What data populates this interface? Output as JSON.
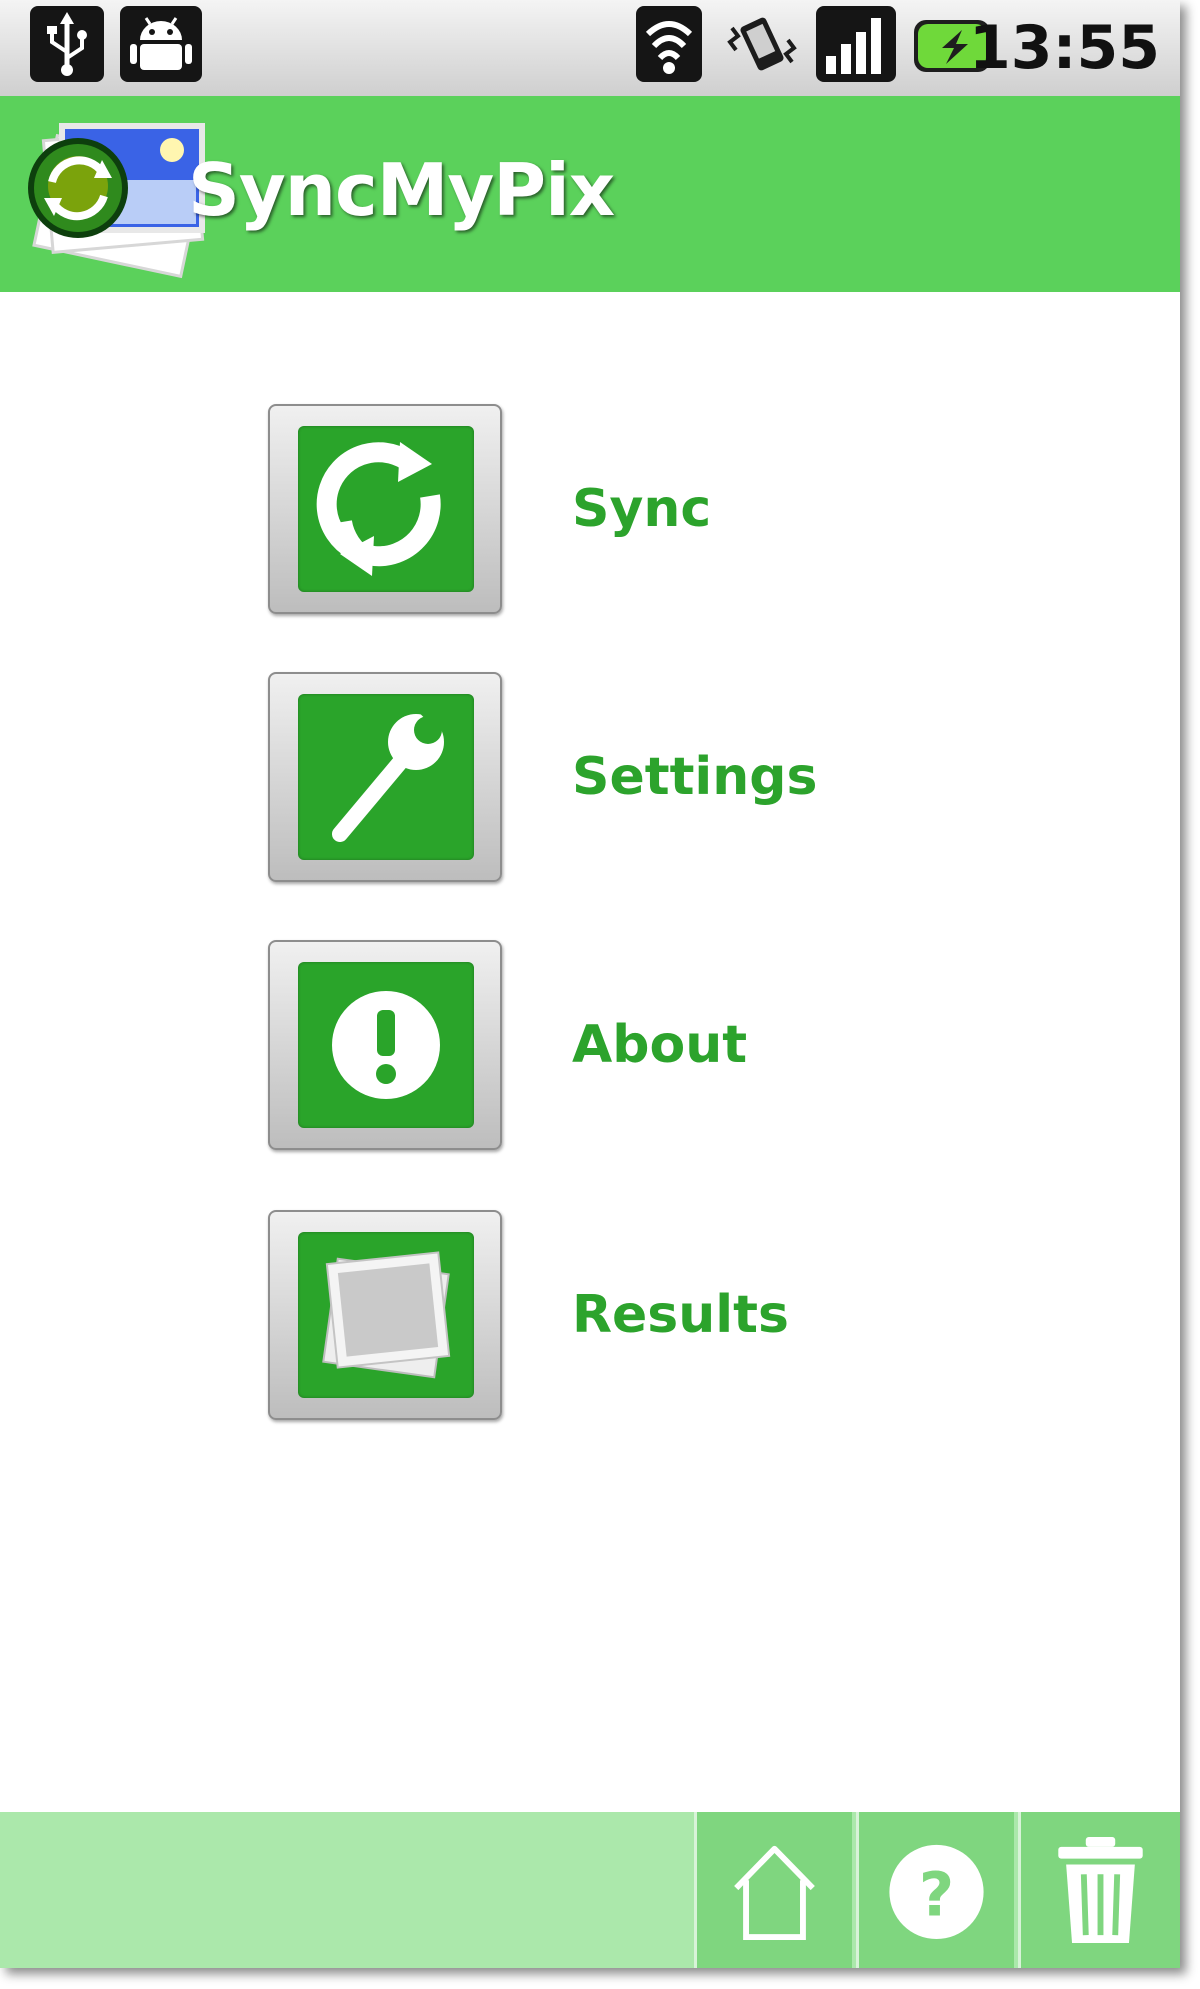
{
  "status_bar": {
    "time": "13:55",
    "left_icons": [
      "usb-icon",
      "android-debug-icon"
    ],
    "right_icons": [
      "wifi-icon",
      "vibrate-icon",
      "signal-icon",
      "battery-icon"
    ]
  },
  "app": {
    "title": "SyncMyPix",
    "logo_icon": "syncmypix-logo-icon"
  },
  "menu": {
    "items": [
      {
        "label": "Sync",
        "icon": "sync-icon"
      },
      {
        "label": "Settings",
        "icon": "wrench-icon"
      },
      {
        "label": "About",
        "icon": "exclamation-icon"
      },
      {
        "label": "Results",
        "icon": "photos-icon"
      }
    ]
  },
  "bottom_bar": {
    "buttons": [
      {
        "icon": "home-icon"
      },
      {
        "icon": "help-icon",
        "glyph": "?"
      },
      {
        "icon": "trash-icon"
      }
    ]
  },
  "colors": {
    "header_green": "#5bd15b",
    "tile_green": "#2aa42a",
    "label_green": "#2ca32c",
    "bottom_bar_light": "#abe8ab",
    "bottom_bar_button": "#7fd67f"
  }
}
